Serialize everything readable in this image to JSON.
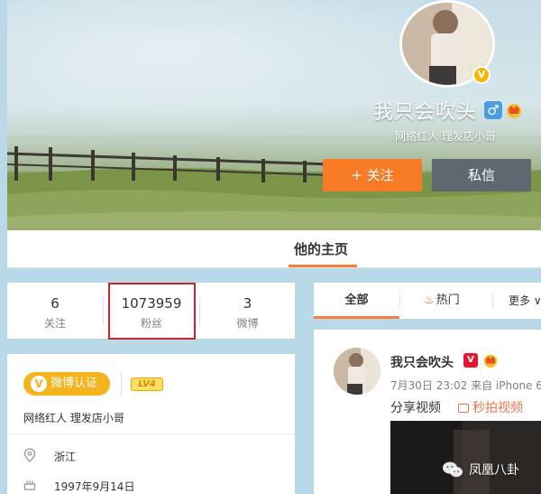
{
  "profile": {
    "nickname": "我只会吹头",
    "intro": "网络红人 理发店小哥",
    "follow_button": "+ 关注",
    "message_button": "私信",
    "avatar_badge": "V"
  },
  "tabs": {
    "home": "他的主页"
  },
  "counters": [
    {
      "value": "6",
      "label": "关注"
    },
    {
      "value": "1073959",
      "label": "粉丝"
    },
    {
      "value": "3",
      "label": "微博"
    }
  ],
  "info": {
    "verify_label": "微博认证",
    "verify_badge": "V",
    "level": "LV4",
    "intro": "网络红人 理发店小哥",
    "location": "浙江",
    "birthday": "1997年9月14日"
  },
  "feed_tabs": {
    "all": "全部",
    "hot": "热门",
    "more": "更多 ∨"
  },
  "post": {
    "name": "我只会吹头",
    "v_badge": "V",
    "meta": "7月30日 23:02 来自 iPhone 6",
    "text": "分享视频",
    "link": "秒拍视频"
  },
  "watermark": "凤凰八卦",
  "colors": {
    "accent": "#fa7d3c",
    "follow_button": "#f77a25",
    "message_button": "#5f6770",
    "highlight_box": "#c8262c",
    "verify": "#f5b31c"
  }
}
